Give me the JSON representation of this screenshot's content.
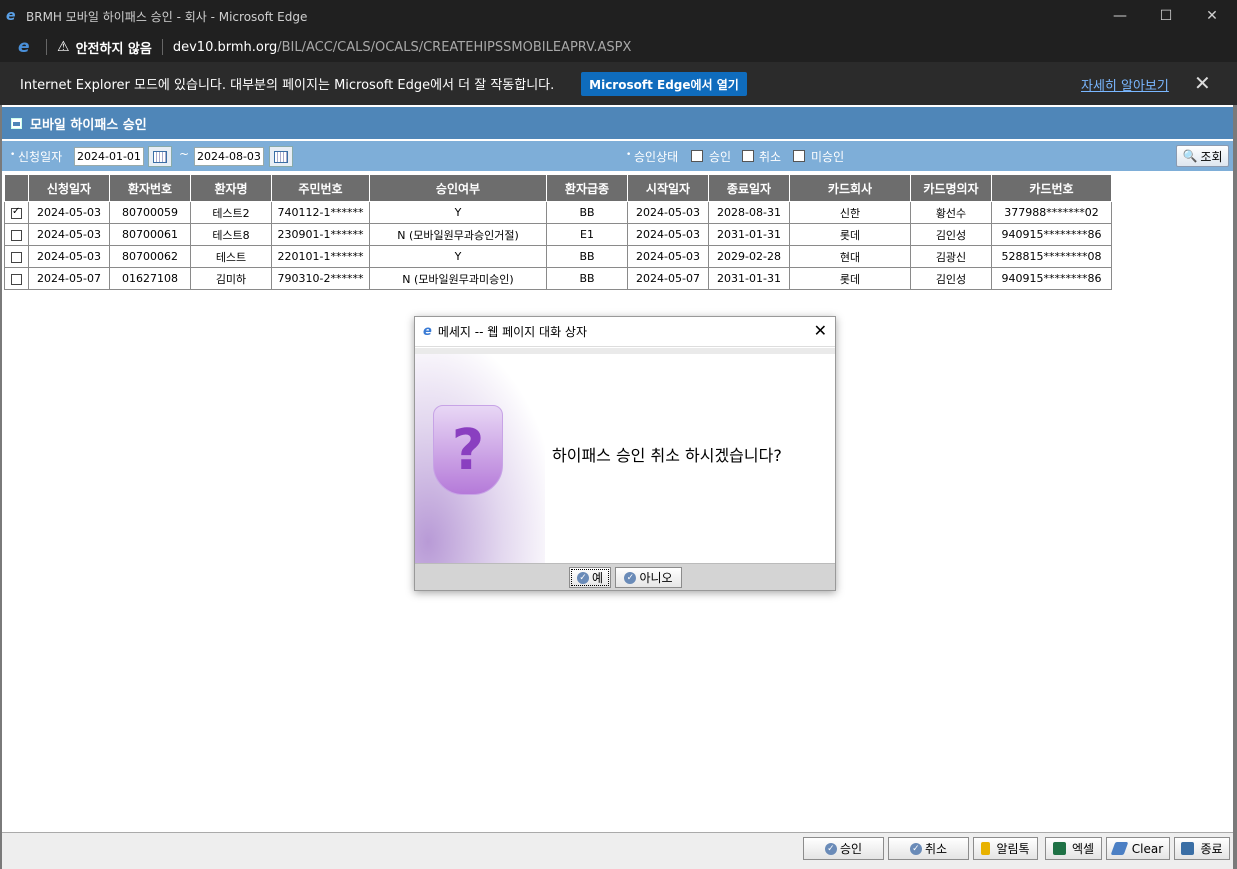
{
  "window": {
    "title": "BRMH 모바일 하이패스 승인 - 회사 - Microsoft Edge"
  },
  "address": {
    "warning": "안전하지 않음",
    "host": "dev10.brmh.org",
    "path": "/BIL/ACC/CALS/OCALS/CREATEHIPSSMOBILEAPRV.ASPX"
  },
  "infobar": {
    "message": "Internet Explorer 모드에 있습니다. 대부분의 페이지는 Microsoft Edge에서 더 잘 작동합니다.",
    "open_button": "Microsoft Edge에서 열기",
    "learn_more": "자세히 알아보기"
  },
  "panel": {
    "title": "모바일 하이패스 승인"
  },
  "search": {
    "date_label": "신청일자",
    "from": "2024-01-01",
    "tilde": "~",
    "to": "2024-08-03",
    "status_label": "승인상태",
    "opt_approve": "승인",
    "opt_cancel": "취소",
    "opt_unapproved": "미승인",
    "search_button": "조회"
  },
  "grid": {
    "headers": [
      "신청일자",
      "환자번호",
      "환자명",
      "주민번호",
      "승인여부",
      "환자급종",
      "시작일자",
      "종료일자",
      "카드회사",
      "카드명의자",
      "카드번호"
    ],
    "rows": [
      {
        "checked": true,
        "cells": [
          "2024-05-03",
          "80700059",
          "테스트2",
          "740112-1******",
          "Y",
          "BB",
          "2024-05-03",
          "2028-08-31",
          "신한",
          "황선수",
          "377988*******02"
        ]
      },
      {
        "checked": false,
        "cells": [
          "2024-05-03",
          "80700061",
          "테스트8",
          "230901-1******",
          "N (모바일원무과승인거절)",
          "E1",
          "2024-05-03",
          "2031-01-31",
          "롯데",
          "김인성",
          "940915********86"
        ]
      },
      {
        "checked": false,
        "cells": [
          "2024-05-03",
          "80700062",
          "테스트",
          "220101-1******",
          "Y",
          "BB",
          "2024-05-03",
          "2029-02-28",
          "현대",
          "김광신",
          "528815********08"
        ]
      },
      {
        "checked": false,
        "cells": [
          "2024-05-07",
          "01627108",
          "김미하",
          "790310-2******",
          "N (모바일원무과미승인)",
          "BB",
          "2024-05-07",
          "2031-01-31",
          "롯데",
          "김인성",
          "940915********86"
        ]
      }
    ]
  },
  "dialog": {
    "title": "메세지 -- 웹 페이지 대화 상자",
    "message": "하이패스 승인 취소 하시겠습니다?",
    "yes": "예",
    "no": "아니오"
  },
  "toolbar": {
    "approve": "승인",
    "cancel": "취소",
    "notify": "알림톡",
    "excel": "엑셀",
    "clear": "Clear",
    "close": "종료"
  }
}
